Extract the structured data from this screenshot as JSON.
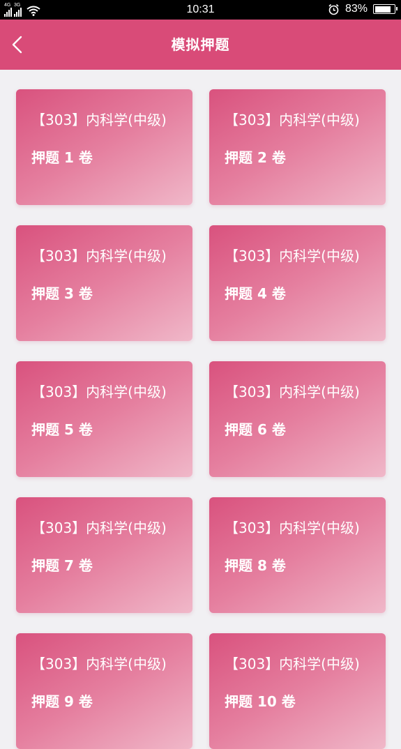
{
  "status_bar": {
    "network_1": "4G",
    "network_2": "3G",
    "time": "10:31",
    "battery_percent": "83%",
    "battery_level": 0.83
  },
  "app_bar": {
    "title": "模拟押题"
  },
  "cards": [
    {
      "subject": "【303】内科学(中级)",
      "volume": "押题 1 卷"
    },
    {
      "subject": "【303】内科学(中级)",
      "volume": "押题 2 卷"
    },
    {
      "subject": "【303】内科学(中级)",
      "volume": "押题 3 卷"
    },
    {
      "subject": "【303】内科学(中级)",
      "volume": "押题 4 卷"
    },
    {
      "subject": "【303】内科学(中级)",
      "volume": "押题 5 卷"
    },
    {
      "subject": "【303】内科学(中级)",
      "volume": "押题 6 卷"
    },
    {
      "subject": "【303】内科学(中级)",
      "volume": "押题 7 卷"
    },
    {
      "subject": "【303】内科学(中级)",
      "volume": "押题 8 卷"
    },
    {
      "subject": "【303】内科学(中级)",
      "volume": "押题 9 卷"
    },
    {
      "subject": "【303】内科学(中级)",
      "volume": "押题 10 卷"
    }
  ],
  "colors": {
    "accent": "#d94b78",
    "card_gradient_start": "#d9527e",
    "card_gradient_end": "#f0b8c9",
    "page_background": "#f1f0f3"
  }
}
